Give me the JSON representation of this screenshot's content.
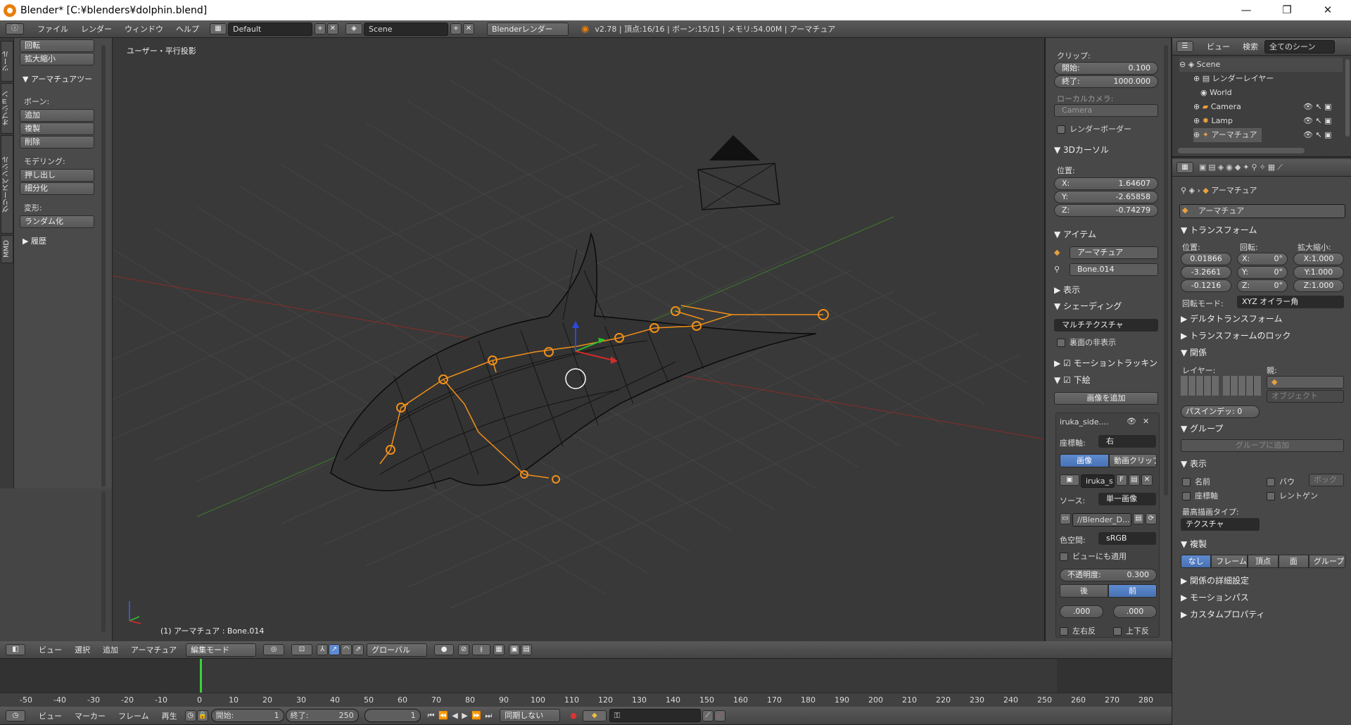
{
  "titlebar": {
    "title": "Blender* [C:¥blenders¥dolphin.blend]",
    "minimize": "—",
    "restore": "❐",
    "close": "✕"
  },
  "info_header": {
    "menus": [
      "ファイル",
      "レンダー",
      "ウィンドウ",
      "ヘルプ"
    ],
    "screen_layout": "Default",
    "scene": "Scene",
    "render_engine": "Blenderレンダー",
    "stats": "v2.78 | 頂点:16/16 | ボーン:15/15 | メモリ:54.00M | アーマチュア"
  },
  "toolshelf": {
    "top_buttons": [
      "回転",
      "拡大縮小"
    ],
    "armature_panel_title": "▼ アーマチュアツー",
    "bones_label": "ボーン:",
    "bone_buttons": [
      "追加",
      "複製",
      "削除"
    ],
    "modeling_label": "モデリング:",
    "modeling_buttons": [
      "押し出し",
      "細分化"
    ],
    "deform_label": "変形:",
    "deform_buttons": [
      "ランダム化"
    ],
    "history_title": "▶ 履歴",
    "tabs": [
      "ツール",
      "オプション",
      "グリースペンシル",
      "MMD"
    ]
  },
  "viewport": {
    "view_label": "ユーザー・平行投影",
    "object_info": "(1) アーマチュア : Bone.014"
  },
  "npanel": {
    "clip_label": "クリップ:",
    "clip_start_label": "開始:",
    "clip_start": "0.100",
    "clip_end_label": "終了:",
    "clip_end": "1000.000",
    "local_camera_label": "ローカルカメラ:",
    "local_camera": "Camera",
    "render_border": "レンダーボーダー",
    "cursor_title": "▼ 3Dカーソル",
    "location_label": "位置:",
    "cursor_x_label": "X:",
    "cursor_x": "1.64607",
    "cursor_y_label": "Y:",
    "cursor_y": "-2.65858",
    "cursor_z_label": "Z:",
    "cursor_z": "-0.74279",
    "item_title": "▼ アイテム",
    "item_object": "アーマチュア",
    "item_bone": "Bone.014",
    "display_title": "▶ 表示",
    "shading_title": "▼ シェーディング",
    "shading_mode": "マルチテクスチャ",
    "backface": "裏面の非表示",
    "motion_tracking": "▶ ☑ モーショントラッキン",
    "background_title": "▼ ☑ 下絵",
    "add_image": "画像を追加",
    "bg_name": "iruka_side....",
    "axis_label": "座標軸:",
    "axis_value": "右",
    "tab_image": "画像",
    "tab_movieclip": "動画クリップ",
    "image_name": "iruka_s",
    "image_f": "F",
    "source_label": "ソース:",
    "source_value": "単一画像",
    "filepath": "//Blender_D...",
    "colorspace_label": "色空間:",
    "colorspace_value": "sRGB",
    "view_as_render": "ビューにも適用",
    "opacity_label": "不透明度:",
    "opacity_value": "0.300",
    "back_label": "後",
    "front_label": "前",
    "offset_x": ".000",
    "offset_y": ".000",
    "flip_x": "左右反",
    "flip_y": "上下反"
  },
  "outliner": {
    "view_menu": "ビュー",
    "search_menu": "検索",
    "filter": "全てのシーン",
    "items": [
      {
        "label": "Scene",
        "indent": 0
      },
      {
        "label": "レンダーレイヤー",
        "indent": 1
      },
      {
        "label": "World",
        "indent": 1
      },
      {
        "label": "Camera",
        "indent": 1
      },
      {
        "label": "Lamp",
        "indent": 1
      },
      {
        "label": "アーマチュア",
        "indent": 1
      }
    ]
  },
  "properties": {
    "breadcrumb": "アーマチュア",
    "object_name": "アーマチュア",
    "transform_title": "▼ トランスフォーム",
    "location_label": "位置:",
    "rotation_label": "回転:",
    "scale_label": "拡大縮小:",
    "loc": [
      "0.01866",
      "-3.2661",
      "-0.1216"
    ],
    "rot": [
      "X:",
      "Y:",
      "Z:"
    ],
    "rot_vals": [
      "0°",
      "0°",
      "0°"
    ],
    "scale": [
      "X:1.000",
      "Y:1.000",
      "Z:1.000"
    ],
    "rotation_mode_label": "回転モード:",
    "rotation_mode": "XYZ オイラー角",
    "delta_title": "▶ デルタトランスフォーム",
    "lock_title": "▶ トランスフォームのロック",
    "relations_title": "▼ 関係",
    "layers_label": "レイヤー:",
    "parent_label": "親:",
    "parent_type": "オブジェクト",
    "pass_index": "パスインデッ: 0",
    "groups_title": "▼ グループ",
    "add_to_group": "グループに追加",
    "display_title": "▼ 表示",
    "name_cb": "名前",
    "bounds_cb": "バウ",
    "bounds_type": "ボック",
    "axis_cb": "座標軸",
    "xray_cb": "レントゲン",
    "maxdraw_label": "最高描画タイプ:",
    "maxdraw_value": "テクスチャ",
    "duplication_title": "▼ 複製",
    "dup_tabs": [
      "なし",
      "フレーム",
      "頂点",
      "面",
      "グループ"
    ],
    "rel_extra_title": "▶ 関係の詳細設定",
    "motion_paths_title": "▶ モーションパス",
    "custom_props_title": "▶ カスタムプロパティ"
  },
  "view3d_header": {
    "menus": [
      "ビュー",
      "選択",
      "追加",
      "アーマチュア"
    ],
    "mode": "編集モード",
    "orientation": "グローバル"
  },
  "timeline": {
    "ticks": [
      "-50",
      "-40",
      "-30",
      "-20",
      "-10",
      "0",
      "10",
      "20",
      "30",
      "40",
      "50",
      "60",
      "70",
      "80",
      "90",
      "100",
      "110",
      "120",
      "130",
      "140",
      "150",
      "160",
      "170",
      "180",
      "190",
      "200",
      "210",
      "220",
      "230",
      "240",
      "250",
      "260",
      "270",
      "280"
    ],
    "menus": [
      "ビュー",
      "マーカー",
      "フレーム",
      "再生"
    ],
    "start_label": "開始:",
    "start": "1",
    "end_label": "終了:",
    "end": "250",
    "current": "1",
    "sync": "同期しない"
  }
}
